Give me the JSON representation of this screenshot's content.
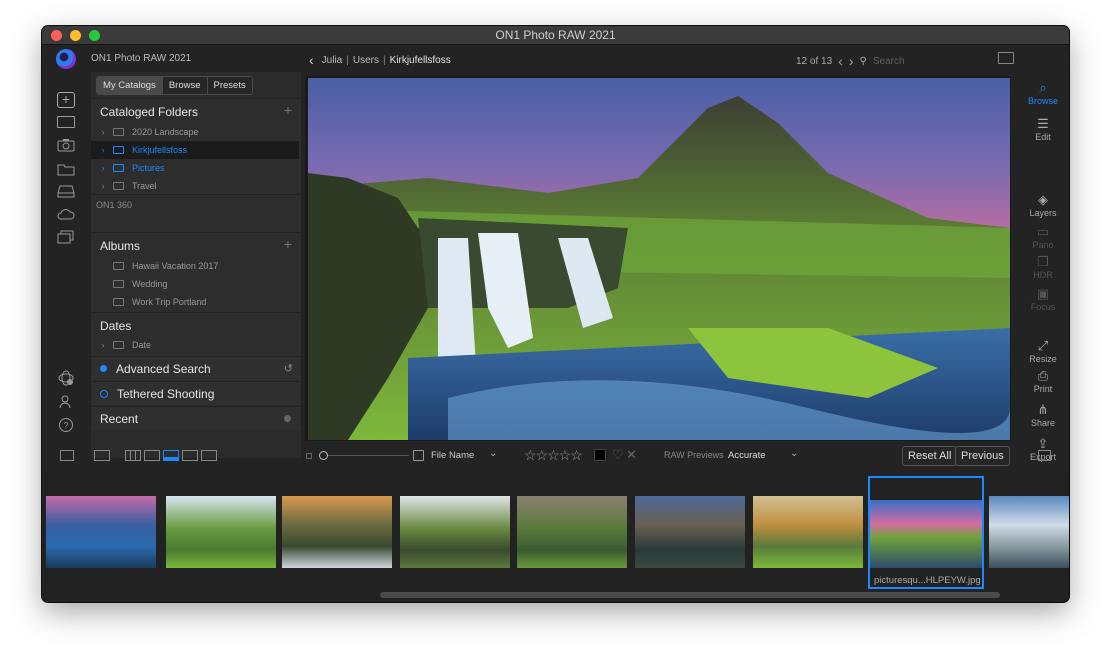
{
  "window": {
    "title": "ON1 Photo RAW 2021"
  },
  "header": {
    "app_title": "ON1 Photo RAW 2021",
    "breadcrumb": [
      "Julia",
      "Users",
      "Kirkjufellsfoss"
    ],
    "position": "12 of 13",
    "search_placeholder": "Search"
  },
  "panel": {
    "tabs": [
      {
        "label": "My Catalogs",
        "active": true
      },
      {
        "label": "Browse"
      },
      {
        "label": "Presets"
      }
    ],
    "cataloged_folders": {
      "title": "Cataloged Folders",
      "items": [
        {
          "label": "2020 Landscape",
          "state": "normal"
        },
        {
          "label": "Kirkjufellsfoss",
          "state": "selected"
        },
        {
          "label": "Pictures",
          "state": "highlight"
        },
        {
          "label": "Travel",
          "state": "normal"
        }
      ]
    },
    "on1_360": "ON1 360",
    "albums": {
      "title": "Albums",
      "items": [
        "Hawaii Vacation 2017",
        "Wedding",
        "Work Trip Portland"
      ]
    },
    "dates": {
      "title": "Dates",
      "items": [
        "Date"
      ]
    },
    "advanced_search": "Advanced Search",
    "tethered_shooting": "Tethered Shooting",
    "recent": "Recent"
  },
  "right_tools": [
    {
      "label": "Browse",
      "state": "active"
    },
    {
      "label": "Edit",
      "state": "normal"
    },
    {
      "label": "Layers",
      "state": "normal"
    },
    {
      "label": "Pano",
      "state": "dim"
    },
    {
      "label": "HDR",
      "state": "dim"
    },
    {
      "label": "Focus",
      "state": "dim"
    },
    {
      "label": "Resize",
      "state": "normal"
    },
    {
      "label": "Print",
      "state": "normal"
    },
    {
      "label": "Share",
      "state": "normal"
    },
    {
      "label": "Export",
      "state": "normal"
    }
  ],
  "bottombar": {
    "sort_label": "File Name",
    "rating_stars": 0,
    "raw_previews_label": "RAW Previews",
    "raw_previews_value": "Accurate",
    "reset_all": "Reset All",
    "previous": "Previous"
  },
  "filmstrip": {
    "selected_index": 7,
    "selected_caption": "picturesqu...HLPEYW.jpg",
    "count_visible": 9
  },
  "colors": {
    "accent": "#1a88ff",
    "bg": "#232323",
    "panel": "#2b2b2b"
  }
}
